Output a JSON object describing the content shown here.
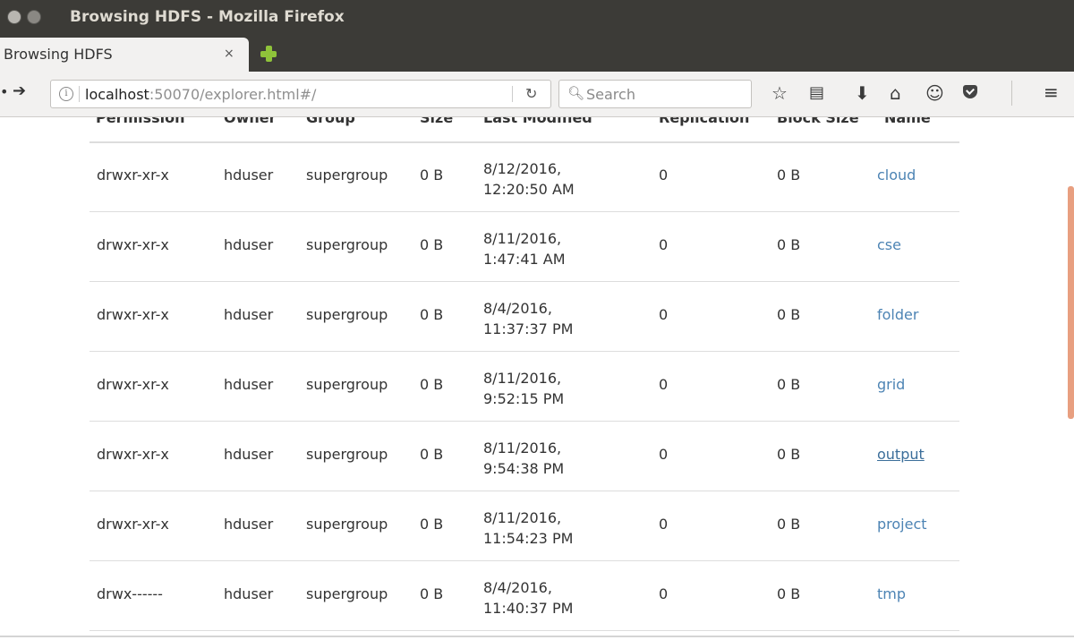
{
  "window": {
    "title": "Browsing HDFS - Mozilla Firefox"
  },
  "tab": {
    "label": "Browsing HDFS",
    "close_glyph": "×"
  },
  "navbar": {
    "url_host": "localhost",
    "url_rest": ":50070/explorer.html#/",
    "search_placeholder": "Search"
  },
  "table": {
    "headers": [
      "Permission",
      "Owner",
      "Group",
      "Size",
      "Last Modified",
      "Replication",
      "Block Size",
      "Name"
    ],
    "rows": [
      {
        "permission": "drwxr-xr-x",
        "owner": "hduser",
        "group": "supergroup",
        "size": "0 B",
        "date": "8/12/2016,",
        "time": "12:20:50 AM",
        "replication": "0",
        "block_size": "0 B",
        "name": "cloud"
      },
      {
        "permission": "drwxr-xr-x",
        "owner": "hduser",
        "group": "supergroup",
        "size": "0 B",
        "date": "8/11/2016,",
        "time": "1:47:41 AM",
        "replication": "0",
        "block_size": "0 B",
        "name": "cse"
      },
      {
        "permission": "drwxr-xr-x",
        "owner": "hduser",
        "group": "supergroup",
        "size": "0 B",
        "date": "8/4/2016,",
        "time": "11:37:37 PM",
        "replication": "0",
        "block_size": "0 B",
        "name": "folder"
      },
      {
        "permission": "drwxr-xr-x",
        "owner": "hduser",
        "group": "supergroup",
        "size": "0 B",
        "date": "8/11/2016,",
        "time": "9:52:15 PM",
        "replication": "0",
        "block_size": "0 B",
        "name": "grid"
      },
      {
        "permission": "drwxr-xr-x",
        "owner": "hduser",
        "group": "supergroup",
        "size": "0 B",
        "date": "8/11/2016,",
        "time": "9:54:38 PM",
        "replication": "0",
        "block_size": "0 B",
        "name": "output"
      },
      {
        "permission": "drwxr-xr-x",
        "owner": "hduser",
        "group": "supergroup",
        "size": "0 B",
        "date": "8/11/2016,",
        "time": "11:54:23 PM",
        "replication": "0",
        "block_size": "0 B",
        "name": "project"
      },
      {
        "permission": "drwx------",
        "owner": "hduser",
        "group": "supergroup",
        "size": "0 B",
        "date": "8/4/2016,",
        "time": "11:40:37 PM",
        "replication": "0",
        "block_size": "0 B",
        "name": "tmp"
      }
    ]
  },
  "colors": {
    "titlebar": "#3c3b37",
    "link": "#4d84b4",
    "scrollbar_thumb": "#e89f80",
    "newtab_plus": "#8fc33a"
  },
  "icons": [
    "info-icon",
    "reload-icon",
    "search-icon",
    "bookmark-star-icon",
    "reading-list-icon",
    "download-icon",
    "home-icon",
    "chat-icon",
    "pocket-icon",
    "hamburger-menu-icon"
  ]
}
